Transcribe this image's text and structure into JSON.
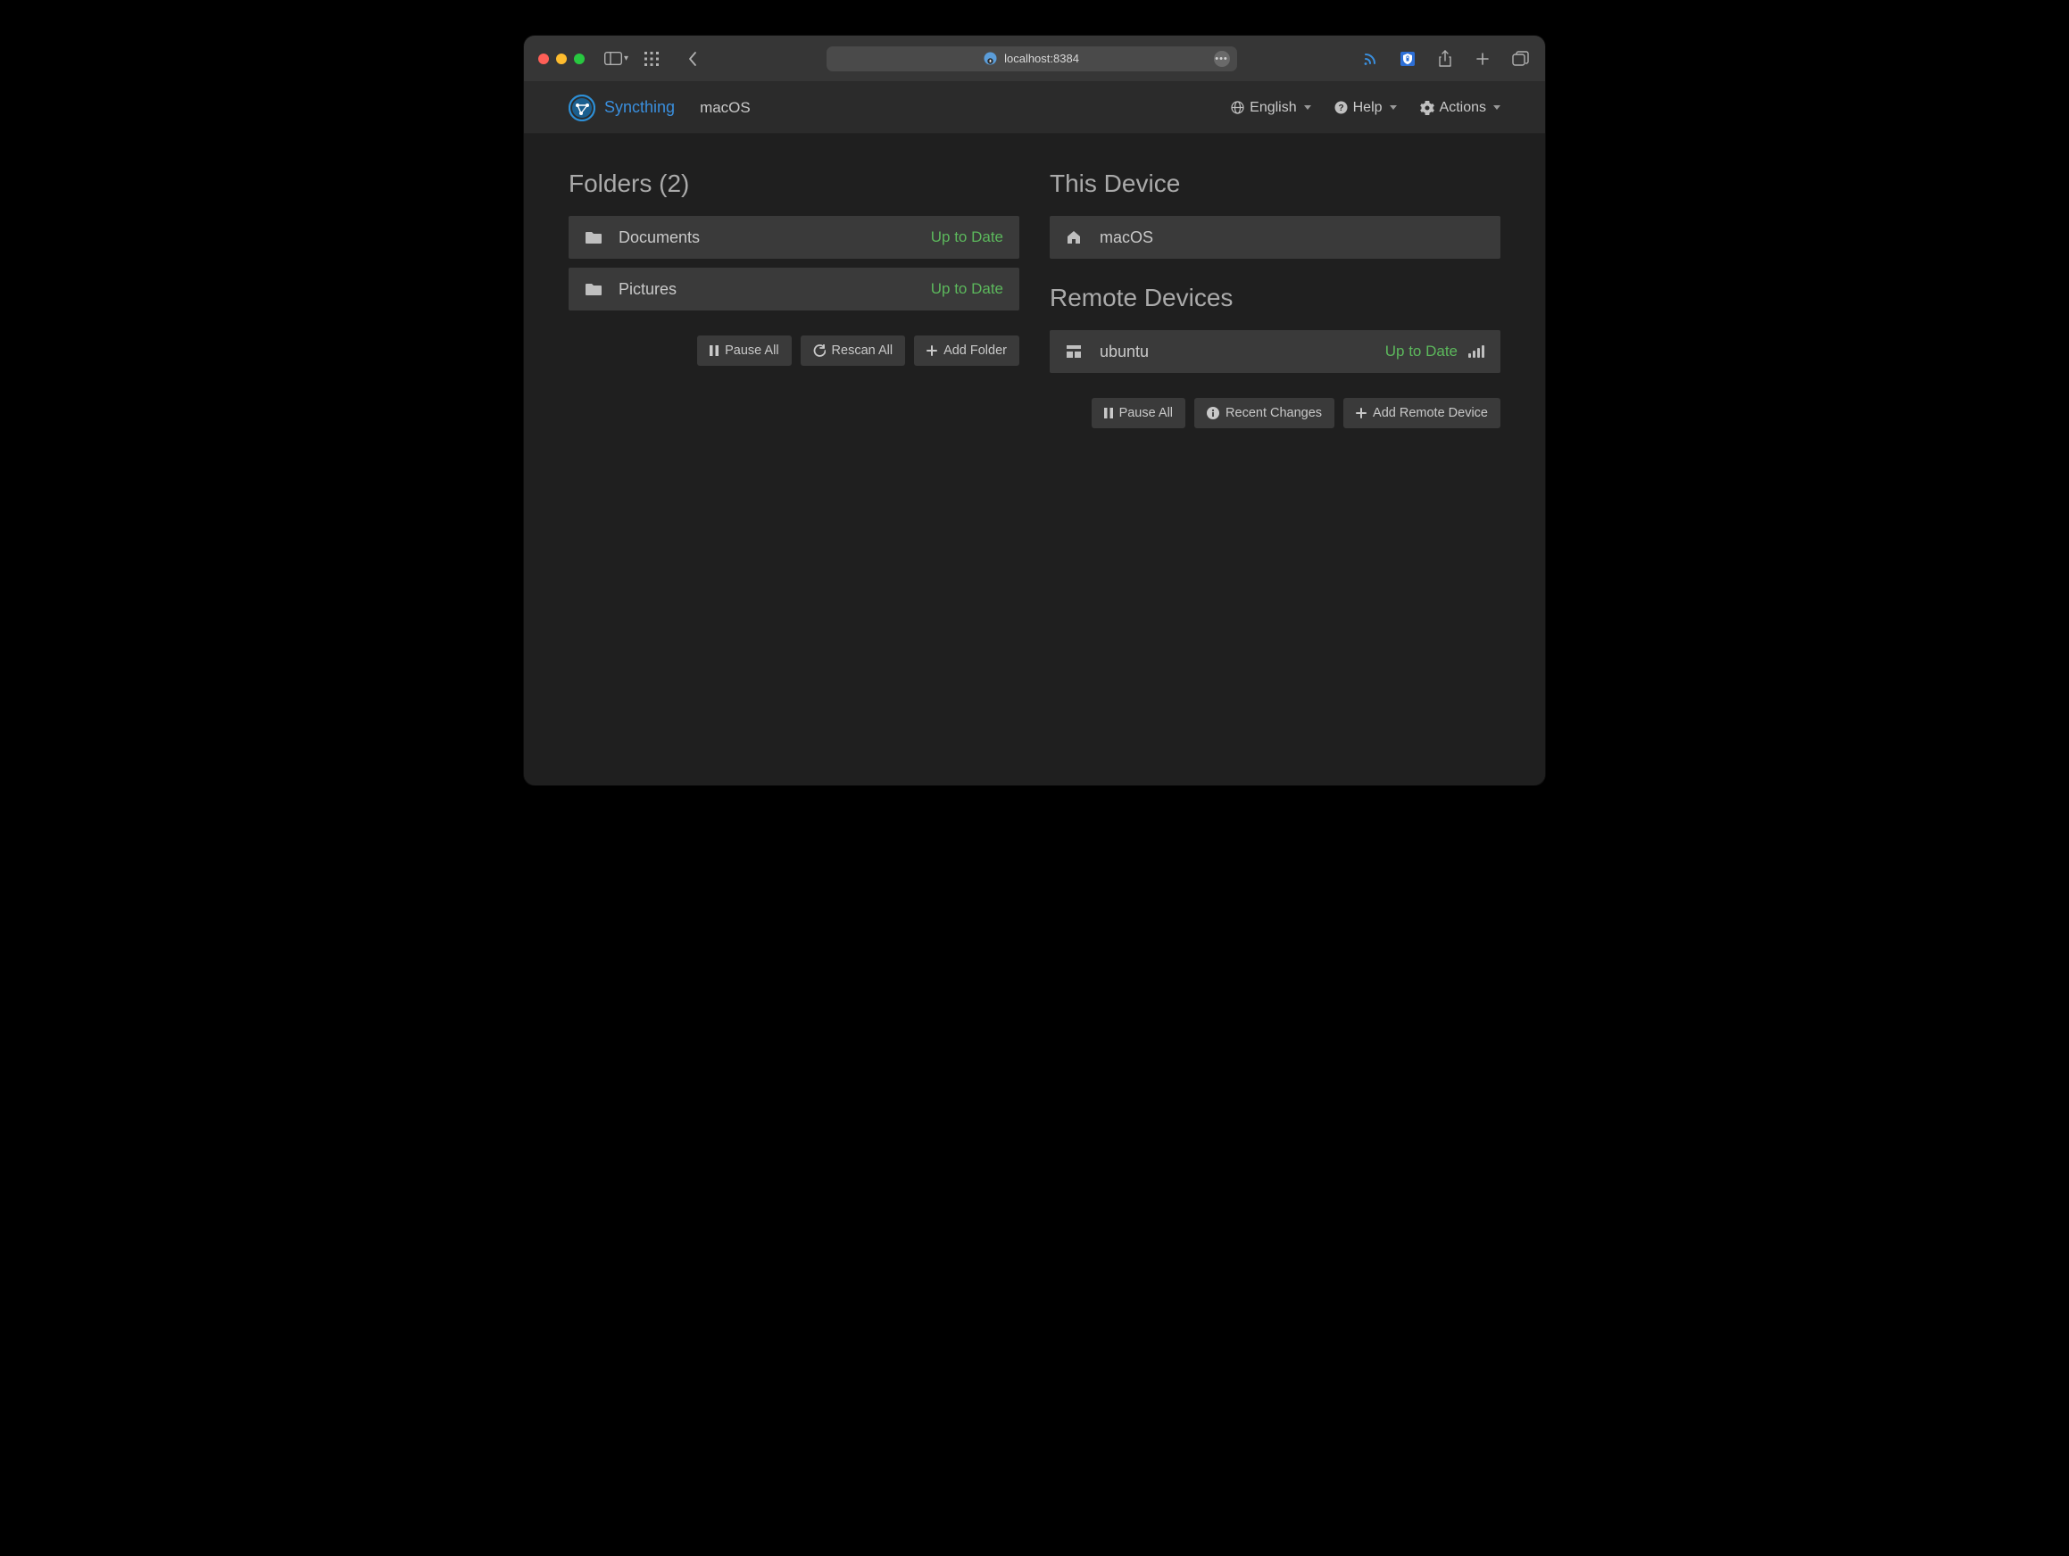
{
  "browser": {
    "address": "localhost:8384"
  },
  "app": {
    "brand": "Syncthing",
    "local_device": "macOS"
  },
  "appmenu": {
    "language": "English",
    "help": "Help",
    "actions": "Actions"
  },
  "folders": {
    "heading": "Folders (2)",
    "items": [
      {
        "name": "Documents",
        "status": "Up to Date"
      },
      {
        "name": "Pictures",
        "status": "Up to Date"
      }
    ],
    "buttons": {
      "pause_all": "Pause All",
      "rescan_all": "Rescan All",
      "add_folder": "Add Folder"
    }
  },
  "this_device": {
    "heading": "This Device",
    "name": "macOS"
  },
  "remote_devices": {
    "heading": "Remote Devices",
    "items": [
      {
        "name": "ubuntu",
        "status": "Up to Date"
      }
    ],
    "buttons": {
      "pause_all": "Pause All",
      "recent_changes": "Recent Changes",
      "add_remote": "Add Remote Device"
    }
  }
}
